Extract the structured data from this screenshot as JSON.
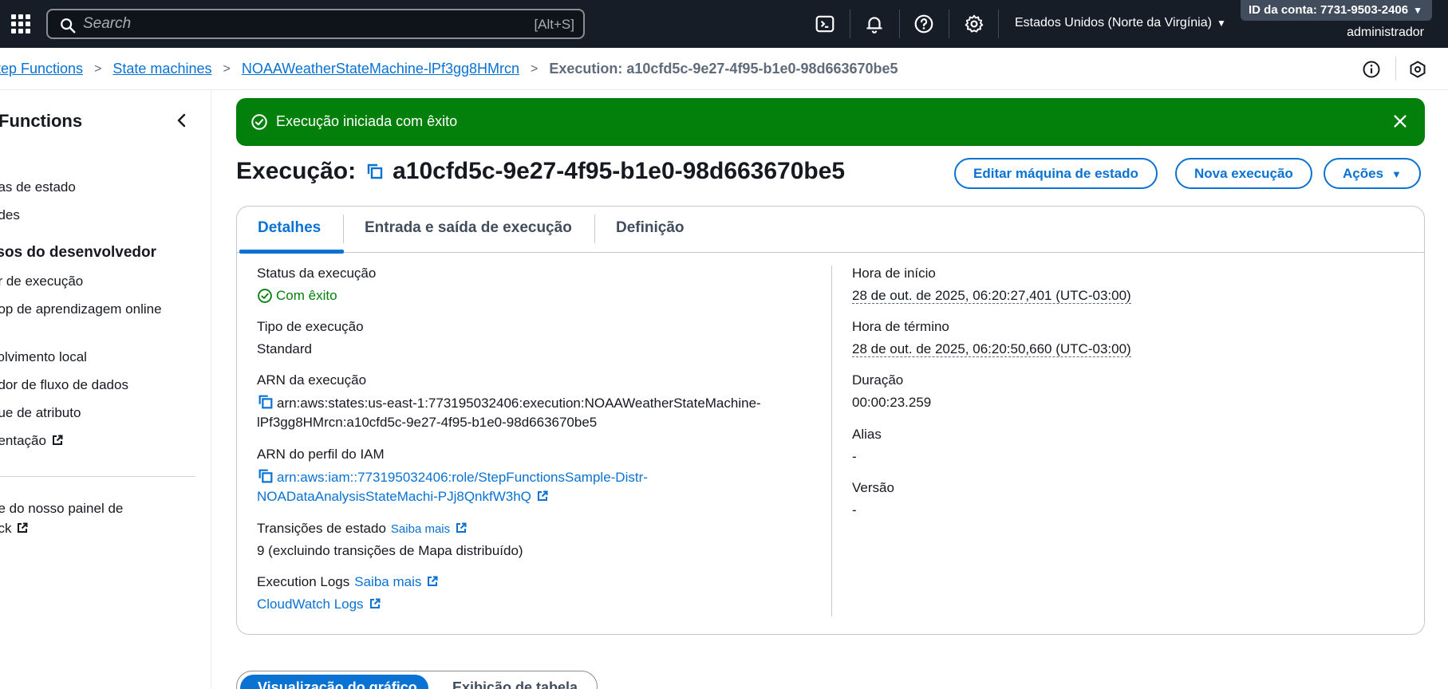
{
  "topbar": {
    "search_placeholder": "Search",
    "search_shortcut": "[Alt+S]",
    "region": "Estados Unidos (Norte da Virgínia)",
    "account_id": "ID da conta: 7731-9503-2406",
    "user": "administrador"
  },
  "breadcrumb": {
    "items": [
      "tep Functions",
      "State machines",
      "NOAAWeatherStateMachine-lPf3gg8HMrcn"
    ],
    "current": "Execution: a10cfd5c-9e27-4f95-b1e0-98d663670be5"
  },
  "sidebar": {
    "title": "Functions",
    "items_top": [
      "nas de estado",
      "ades"
    ],
    "section": "rsos do desenvolvedor",
    "items_dev": [
      "or de execução",
      "hop de aprendizagem online",
      "volvimento local",
      "ador de fluxo de dados",
      "que de atributo",
      "nentação"
    ],
    "feedback_line1": "pe do nosso painel de",
    "feedback_line2": "ack"
  },
  "flash": {
    "message": "Execução iniciada com êxito"
  },
  "header": {
    "prefix": "Execução:",
    "execution_id": "a10cfd5c-9e27-4f95-b1e0-98d663670be5",
    "edit_button": "Editar máquina de estado",
    "new_button": "Nova execução",
    "actions_button": "Ações"
  },
  "tabs": [
    "Detalhes",
    "Entrada e saída de execução",
    "Definição"
  ],
  "details": {
    "status_label": "Status da execução",
    "status_value": "Com êxito",
    "type_label": "Tipo de execução",
    "type_value": "Standard",
    "arn_label": "ARN da execução",
    "arn_line1": "arn:aws:states:us-east-1:773195032406:execution:NOAAWeatherStateMachine-",
    "arn_line2": "lPf3gg8HMrcn:a10cfd5c-9e27-4f95-b1e0-98d663670be5",
    "iam_label": "ARN do perfil do IAM",
    "iam_line1": "arn:aws:iam::773195032406:role/StepFunctionsSample-Distr-",
    "iam_line2": "NOADataAnalysisStateMachi-PJj8QnkfW3hQ",
    "transitions_label": "Transições de estado",
    "learn_more": "Saiba mais",
    "transitions_value": "9 (excluindo transições de Mapa distribuído)",
    "logs_label": "Execution Logs",
    "logs_link": "CloudWatch Logs",
    "start_label": "Hora de início",
    "start_value": "28 de out. de 2025, 06:20:27,401 (UTC-03:00)",
    "end_label": "Hora de término",
    "end_value": "28 de out. de 2025, 06:20:50,660 (UTC-03:00)",
    "duration_label": "Duração",
    "duration_value": "00:00:23.259",
    "alias_label": "Alias",
    "alias_value": "-",
    "version_label": "Versão",
    "version_value": "-"
  },
  "view_toggle": [
    "Visualização do gráfico",
    "Exibição de tabela"
  ],
  "colors": {
    "nav_bg": "#161d26",
    "accent": "#0972d3",
    "success": "#037f0c"
  }
}
